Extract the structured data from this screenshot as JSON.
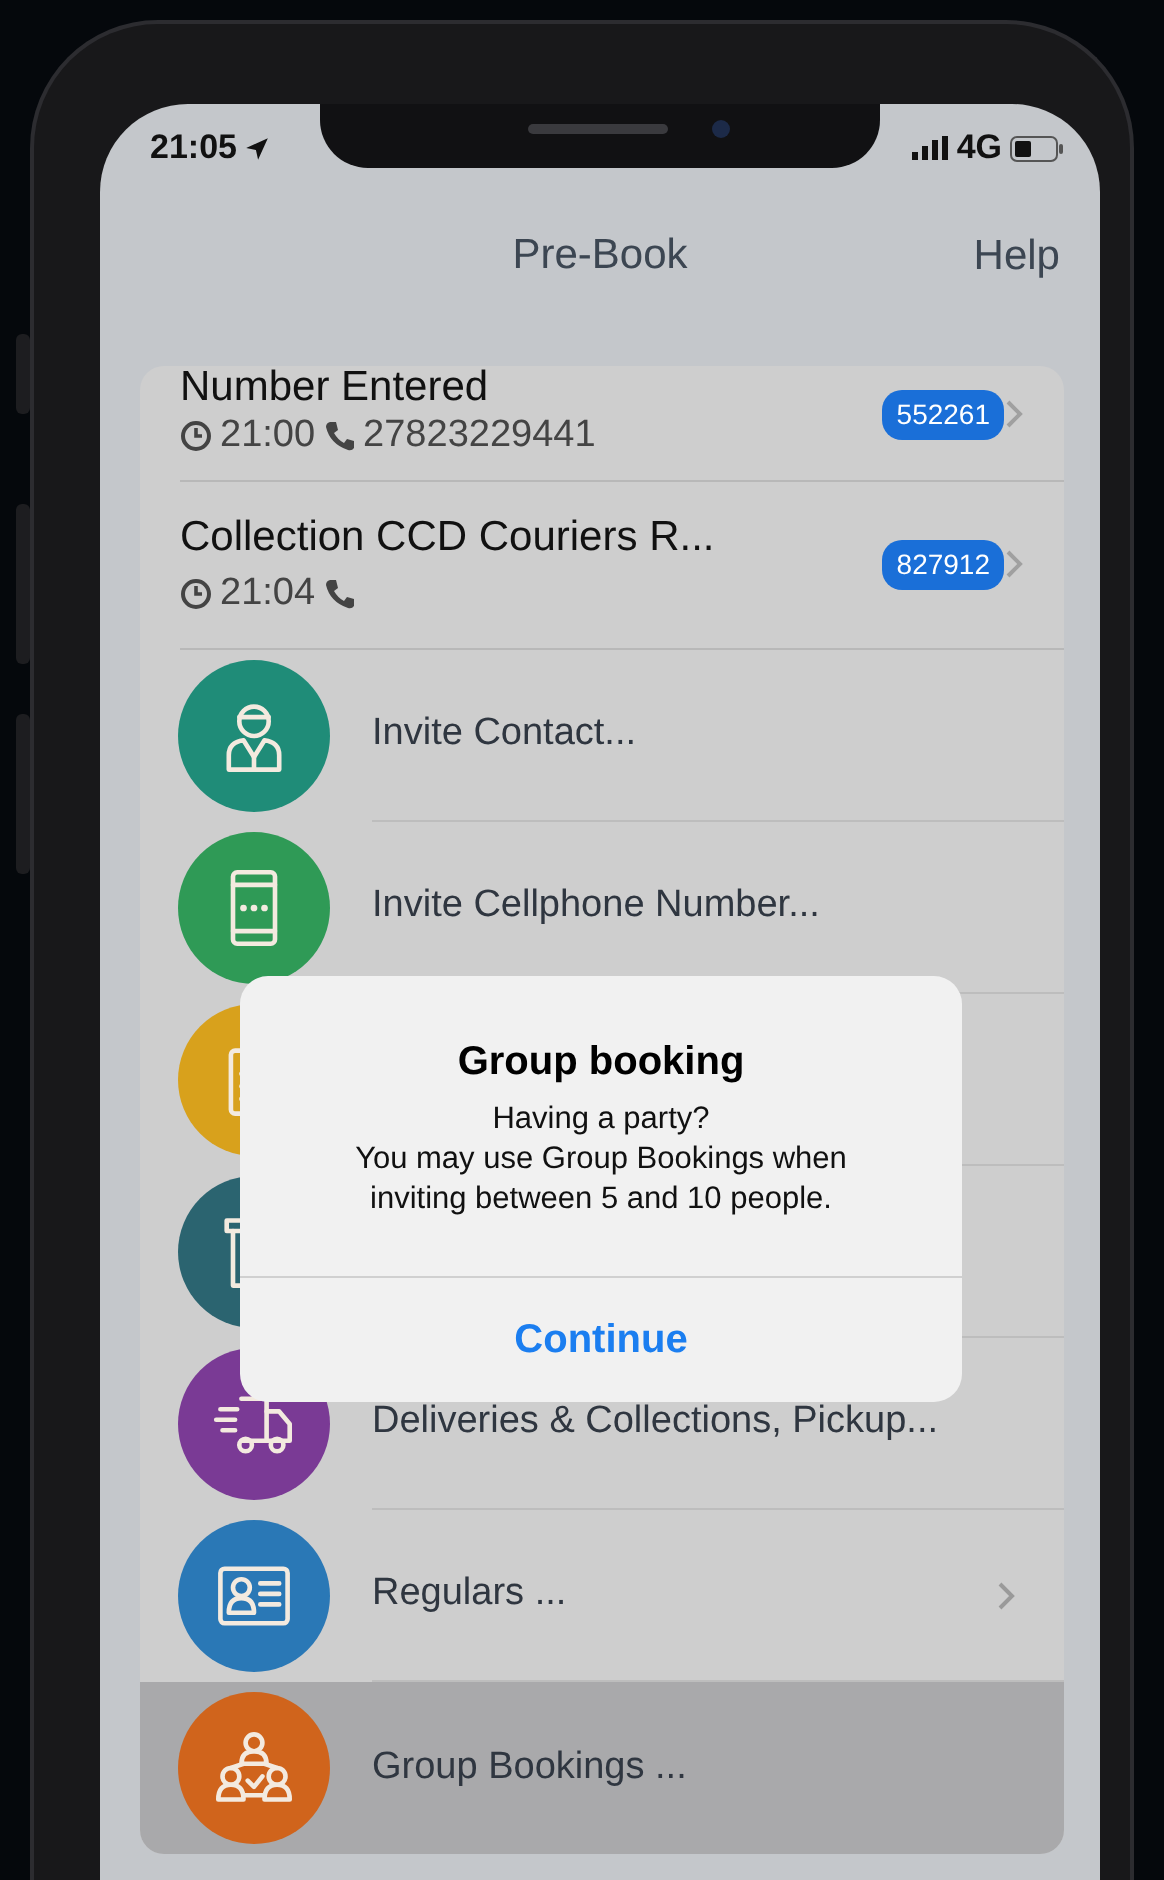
{
  "status_bar": {
    "time": "21:05",
    "network": "4G"
  },
  "nav": {
    "title": "Pre-Book",
    "action": "Help"
  },
  "bookings": [
    {
      "title": "Number Entered",
      "time": "21:00",
      "phone": "27823229441",
      "badge": "552261"
    },
    {
      "title": "Collection CCD Couriers  R...",
      "time": "21:04",
      "badge": "827912"
    }
  ],
  "menu": [
    {
      "kind": "contact",
      "label": "Invite Contact...",
      "color": "#1f8c78",
      "chevron": false,
      "selected": false
    },
    {
      "kind": "cellphone",
      "label": "Invite Cellphone Number...",
      "color": "#2f9a56",
      "chevron": false,
      "selected": false
    },
    {
      "kind": "clipboard",
      "color": "#d8a11c",
      "chevron": false,
      "selected": false
    },
    {
      "kind": "bin",
      "color": "#2b6470",
      "chevron": false,
      "selected": false
    },
    {
      "kind": "delivery",
      "label": "Deliveries & Collections, Pickup...",
      "color": "#7a3a95",
      "chevron": false,
      "selected": false
    },
    {
      "kind": "regulars",
      "label": "Regulars ...",
      "color": "#2a78b6",
      "chevron": true,
      "selected": false
    },
    {
      "kind": "group",
      "label": "Group Bookings ...",
      "color": "#d0641c",
      "chevron": false,
      "selected": true
    }
  ],
  "alert": {
    "title": "Group booking",
    "message_lines": [
      "Having a party?",
      "You may use Group Bookings when",
      "inviting between 5 and 10 people."
    ],
    "button": "Continue"
  }
}
